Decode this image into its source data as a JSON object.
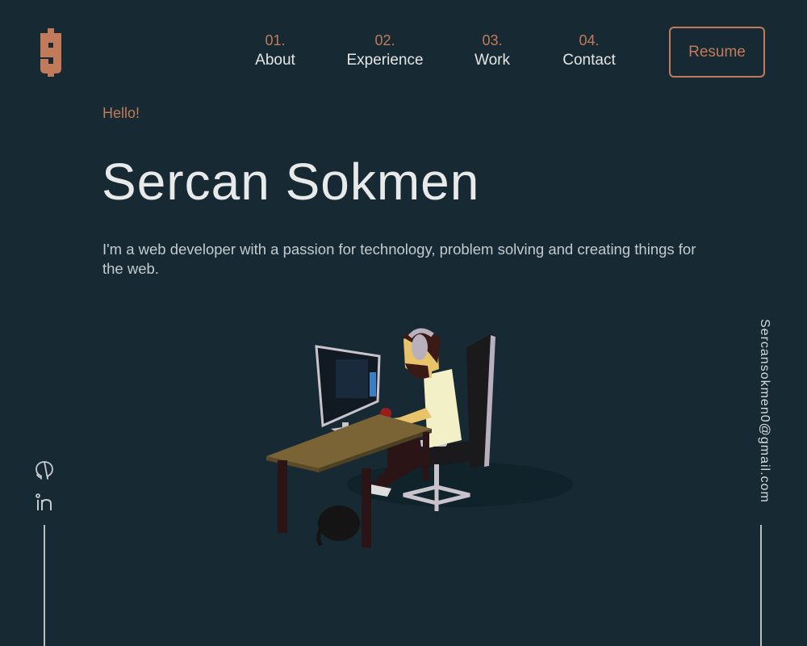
{
  "logo": {
    "letter": "S",
    "color": "#c27b5a"
  },
  "nav": {
    "items": [
      {
        "num": "01.",
        "label": "About"
      },
      {
        "num": "02.",
        "label": "Experience"
      },
      {
        "num": "03.",
        "label": "Work"
      },
      {
        "num": "04.",
        "label": "Contact"
      }
    ],
    "resume_label": "Resume"
  },
  "hero": {
    "greeting": "Hello!",
    "name": "Sercan Sokmen",
    "intro": "I'm a web developer with a passion for technology, problem solving and creating things for the web."
  },
  "social": {
    "icons": [
      "github-icon",
      "linkedin-icon"
    ]
  },
  "contact": {
    "email": "Sercansokmen0@gmail.com"
  },
  "colors": {
    "background": "#172a33",
    "accent": "#c27b5a",
    "text": "#e8eae9",
    "muted": "#c4cbcf"
  }
}
